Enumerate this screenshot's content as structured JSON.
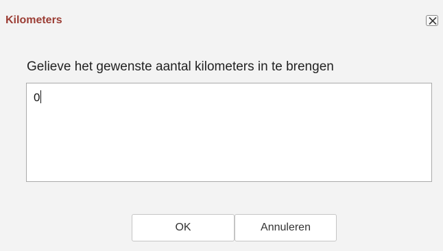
{
  "dialog": {
    "title": "Kilometers",
    "close_icon": "close-icon",
    "prompt": "Gelieve het gewenste aantal kilometers in te brengen",
    "input_value": "0",
    "ok_label": "OK",
    "cancel_label": "Annuleren"
  },
  "colors": {
    "title": "#9b3d34",
    "background": "#f3f3f3"
  }
}
